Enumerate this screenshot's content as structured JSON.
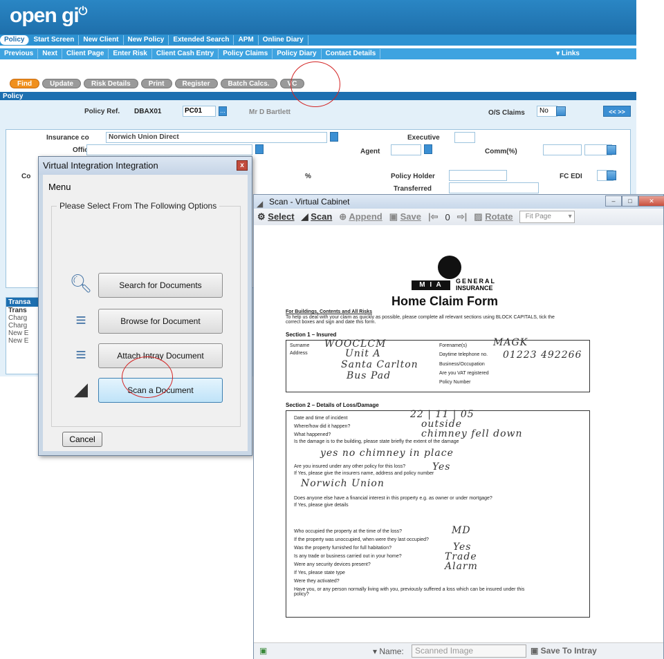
{
  "app": {
    "logo": "open gi",
    "primary_tabs": [
      "Policy",
      "Start Screen",
      "New Client",
      "New Policy",
      "Extended Search",
      "APM",
      "Online Diary"
    ],
    "secondary_tabs": [
      "Previous",
      "Next",
      "Client Page",
      "Enter Risk",
      "Client Cash Entry",
      "Policy Claims",
      "Policy Diary",
      "Contact Details"
    ],
    "links_label": "Links",
    "action_buttons": [
      "Find",
      "Update",
      "Risk Details",
      "Print",
      "Register",
      "Batch Calcs.",
      "VC"
    ],
    "section_tab": "Policy",
    "policy": {
      "policy_ref_label": "Policy Ref.",
      "policy_ref_value": "DBAX01",
      "policy_code": "PC01",
      "client_name": "Mr D Bartlett",
      "os_claims_label": "O/S Claims",
      "os_claims_value": "No",
      "nav": "<< >>"
    },
    "details": {
      "insurance_co_label": "Insurance co",
      "insurance_co_value": "Norwich Union Direct",
      "office_label": "Office",
      "executive_label": "Executive",
      "agent_label": "Agent",
      "comm_label": "Comm(%)",
      "co_label": "Co",
      "percent": "%",
      "policy_holder_label": "Policy Holder",
      "transferred_label": "Transferred",
      "fc_edi_label": "FC EDI"
    },
    "transactions": {
      "header": "Transa",
      "rows": [
        "Trans",
        "Charg",
        "Charg",
        "New E",
        "New E"
      ]
    }
  },
  "vii_dialog": {
    "title": "Virtual Integration Integration",
    "close": "x",
    "menu": "Menu",
    "group_title": "Please Select From The Following Options",
    "options": [
      "Search for Documents",
      "Browse for Document",
      "Attach Intray Document",
      "Scan a Document"
    ],
    "cancel": "Cancel"
  },
  "scan_window": {
    "title": "Scan - Virtual Cabinet",
    "toolbar": {
      "select": "Select",
      "scan": "Scan",
      "append": "Append",
      "save": "Save",
      "page": "0",
      "rotate": "Rotate",
      "fit": "Fit Page"
    },
    "status": {
      "name_label": "Name:",
      "name_value": "Scanned Image",
      "save_intray": "Save To Intray"
    }
  },
  "form": {
    "brand_mia": "M I A",
    "brand_general": "GENERAL",
    "brand_insurance": "INSURANCE",
    "title": "Home Claim Form",
    "subtitle": "For Buildings, Contents and All Risks",
    "intro": "To help us deal with your claim as quickly as possible, please complete all relevant sections using BLOCK CAPITALS, tick the correct boxes and sign and date this form.",
    "section1": "Section 1 – Insured",
    "surname_label": "Surname",
    "address_label": "Address",
    "forename_label": "Forename(s)",
    "daytime_label": "Daytime telephone no.",
    "business_label": "Business/Occupation",
    "vat_label": "Are you VAT registered",
    "policy_number_label": "Policy Number",
    "hw_surname": "WOOCLCM",
    "hw_forename": "MAGK",
    "hw_phone": "01223 492266",
    "hw_addr1": "Unit A",
    "hw_addr2": "Santa Carlton",
    "hw_addr3": "Bus Pad",
    "section2": "Section 2 – Details of Loss/Damage",
    "q_date": "Date and time of incident",
    "q_where": "Where/how did it happen?",
    "q_what": "What happened?",
    "q_damage": "Is the damage is to the building, please state briefly the extent of the damage",
    "q_insured_other": "Are you insured under any other policy for this loss?",
    "q_insurer_name": "If Yes, please give the insurers name, address and policy number",
    "q_financial": "Does anyone else have a financial interest in this property e.g. as owner or under mortgage?",
    "q_details": "If Yes, please give details",
    "q_occupied": "Who occupied the property at the time of the loss?",
    "q_unoccupied": "If the property was unoccupied, when were they last occupied?",
    "q_furnished": "Was the property furnished for full habitation?",
    "q_trade": "Is any trade or business carried out in your home?",
    "q_security": "Were any security devices present?",
    "q_type": "If Yes, please state type",
    "q_activated": "Were they activated?",
    "q_previous": "Have you, or any person normally living with you, previously suffered a loss which can be insured under this policy?",
    "hw_date": "22 | 11 | 05",
    "hw_where": "outside",
    "hw_what": "chimney fell down",
    "hw_damage": "yes no chimney in place",
    "hw_other": "Yes",
    "hw_insurer": "Norwich Union",
    "hw_occupied": "MD",
    "hw_furnished": "Yes",
    "hw_trade": "Trade",
    "hw_security": "Alarm"
  },
  "colors": {
    "banner": "#2a86c4",
    "tab_bar": "#2d92d2",
    "accent_orange": "#f0901e",
    "annotation_red": "#d32424"
  }
}
